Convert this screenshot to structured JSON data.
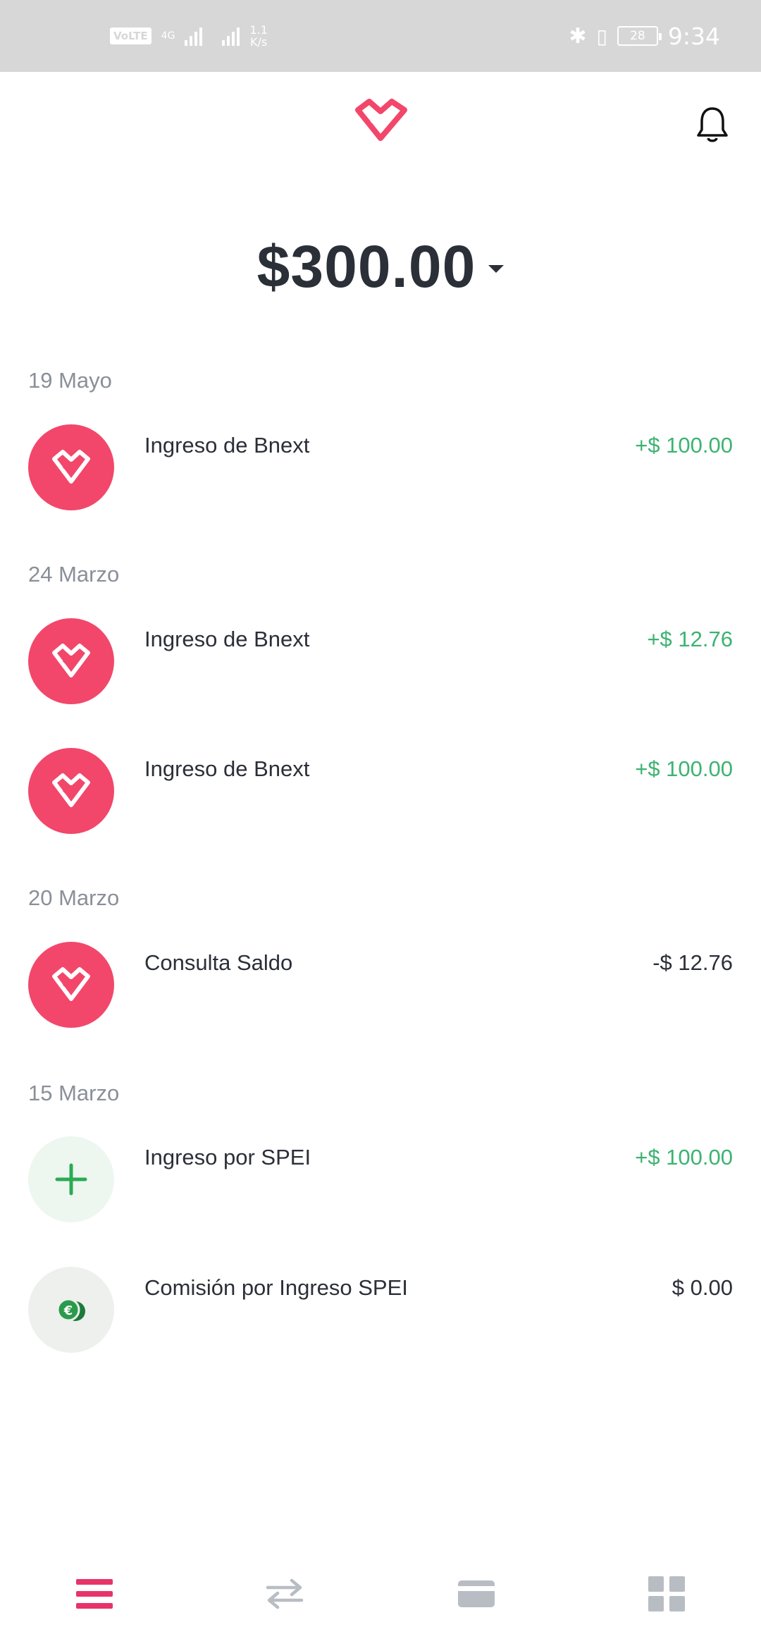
{
  "status_bar": {
    "volte": "VoLTE",
    "network": "4G",
    "speed_value": "1.1",
    "speed_unit": "K/s",
    "battery": "28",
    "time": "9:34"
  },
  "header": {
    "logo_icon": "bnext-heart-logo",
    "notification_icon": "bell-icon"
  },
  "balance": {
    "amount": "$300.00"
  },
  "colors": {
    "brand": "#f2476a",
    "positive": "#3cb371",
    "text": "#2b2f38",
    "muted": "#8a8f98"
  },
  "transactions": [
    {
      "date": "19 Mayo",
      "items": [
        {
          "icon": "bnext-icon",
          "title": "Ingreso de Bnext",
          "amount": "+$ 100.00"
        }
      ]
    },
    {
      "date": "24 Marzo",
      "items": [
        {
          "icon": "bnext-icon",
          "title": "Ingreso de Bnext",
          "amount": "+$ 12.76"
        },
        {
          "icon": "bnext-icon",
          "title": "Ingreso de Bnext",
          "amount": "+$ 100.00"
        }
      ]
    },
    {
      "date": "20 Marzo",
      "items": [
        {
          "icon": "bnext-icon",
          "title": "Consulta Saldo",
          "amount": "-$ 12.76"
        }
      ]
    },
    {
      "date": "15 Marzo",
      "items": [
        {
          "icon": "plus-icon",
          "title": "Ingreso por SPEI",
          "amount": "+$ 100.00"
        },
        {
          "icon": "euro-coins-icon",
          "title": "Comisión por Ingreso SPEI",
          "amount": "$ 0.00"
        }
      ]
    }
  ],
  "bottom_nav": [
    {
      "icon": "menu-icon",
      "active": true
    },
    {
      "icon": "transfer-icon",
      "active": false
    },
    {
      "icon": "card-icon",
      "active": false
    },
    {
      "icon": "grid-icon",
      "active": false
    }
  ]
}
